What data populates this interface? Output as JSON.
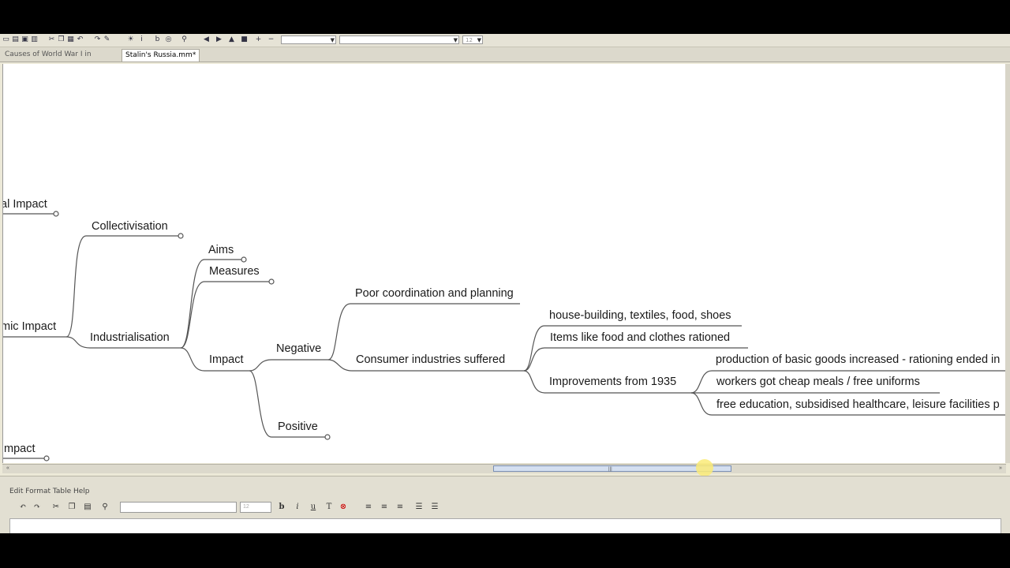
{
  "toolbar": {
    "icons": [
      "new-icon",
      "open-icon",
      "save-icon",
      "print-icon",
      "cut-icon",
      "copy-icon",
      "paste-icon",
      "undo-icon",
      "redo-icon",
      "idea-icon",
      "italic-icon",
      "bold-icon",
      "find-icon",
      "zoom-icon",
      "back-icon",
      "forward-icon",
      "up-icon",
      "down-icon",
      "add-icon",
      "remove-icon"
    ],
    "zoom_value": "",
    "font_value": "",
    "size_value": "12"
  },
  "tabs": [
    {
      "label": "Causes of World War I in Europe.mm"
    },
    {
      "label": "Stalin's Russia.mm*",
      "active": true
    }
  ],
  "mindmap": {
    "nodes": {
      "political_impact": "al Impact",
      "collectivisation": "Collectivisation",
      "aims": "Aims",
      "measures": "Measures",
      "poor_coordination": "Poor coordination and planning",
      "house_building": "house-building, textiles, food, shoes",
      "economic_impact": "mic Impact",
      "items_rationed": "Items like food and clothes rationed",
      "industrialisation": "Industrialisation",
      "negative": "Negative",
      "production_goods": "production of basic goods increased - rationing ended in",
      "impact": "Impact",
      "consumer_industries": "Consumer industries suffered",
      "improvements_1935": "Improvements from 1935",
      "workers_meals": "workers got cheap meals / free uniforms",
      "free_education": "free education, subsidised healthcare, leisure facilities p",
      "positive": "Positive",
      "social_impact": "Impact"
    }
  },
  "notes_panel": {
    "menu": "Edit  Format  Table  Help",
    "bold": "b",
    "italic": "i",
    "underline": "u",
    "size_value": "12"
  }
}
